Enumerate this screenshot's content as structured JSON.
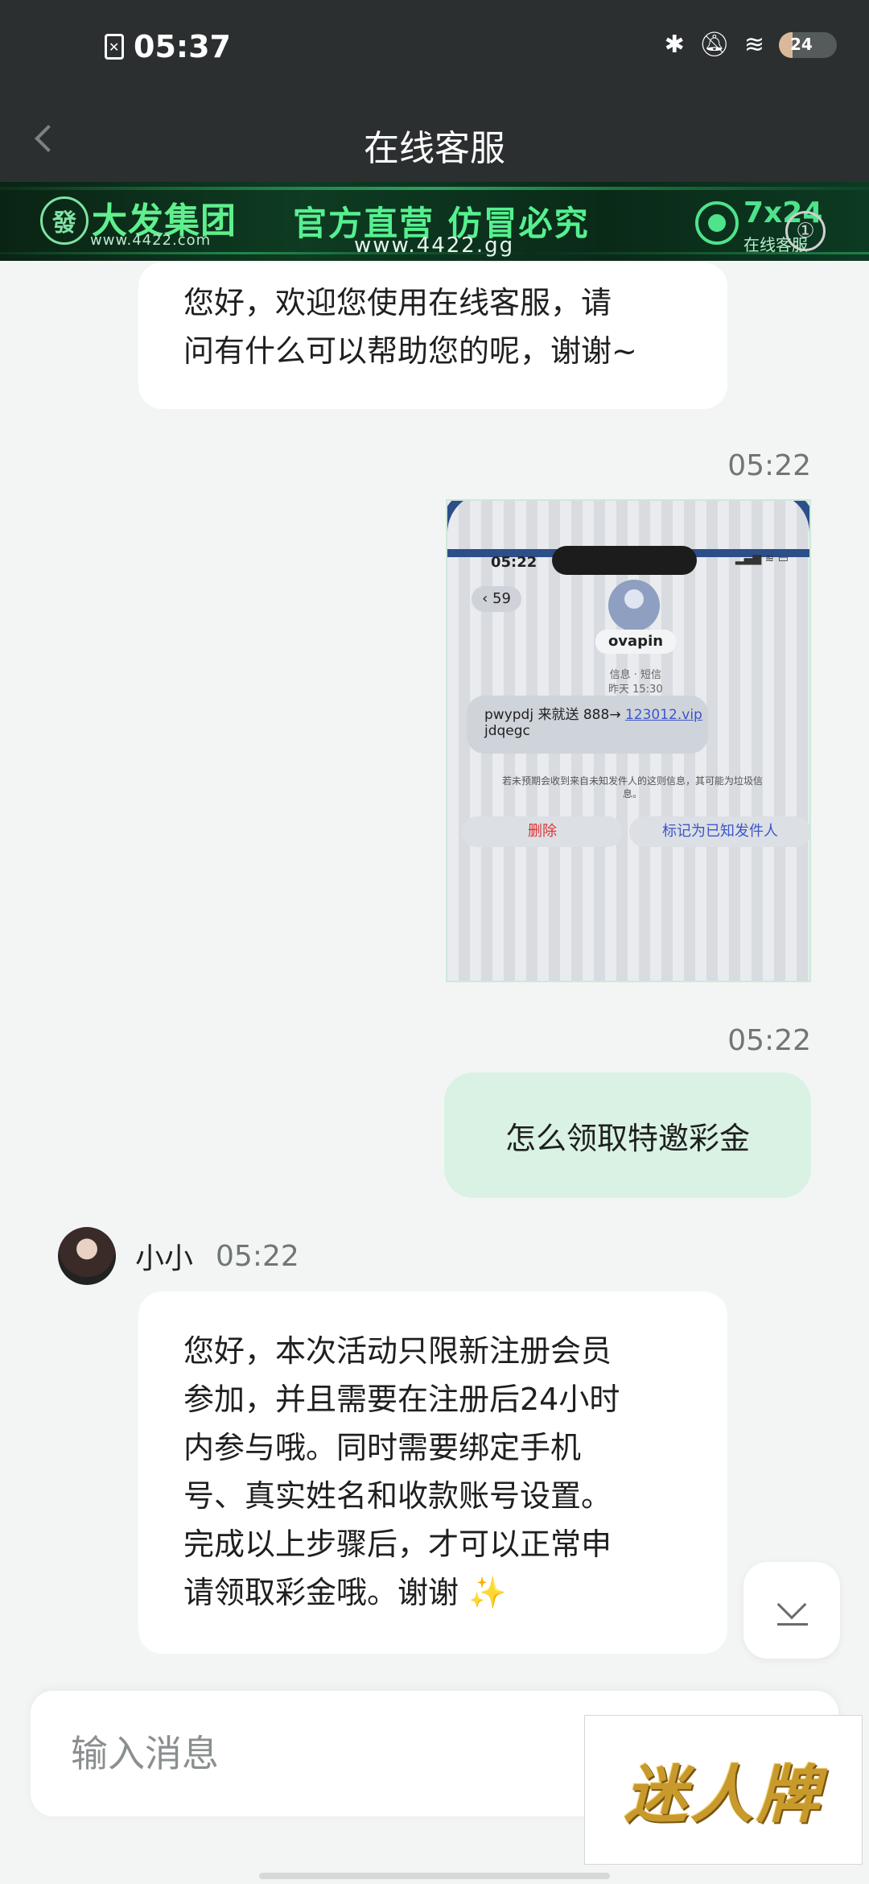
{
  "status_bar": {
    "time": "05:37",
    "battery": "24",
    "battery_level": 0.24
  },
  "nav": {
    "title": "在线客服"
  },
  "banner": {
    "logo_char": "發",
    "brand": "大发集团",
    "brand_url": "www.4422.com",
    "slogan": "官方直营  仿冒必究",
    "slogan_url": "www.4422.gg",
    "service_hours": "7x24",
    "service_label": "在线客服",
    "close_glyph": "①"
  },
  "messages": {
    "greeting_lines": [
      "您好，欢迎您使用在线客服，请",
      "问有什么可以帮助您的呢，谢谢~"
    ],
    "image_time": "05:22",
    "screenshot": {
      "time": "05:22",
      "back_count": "59",
      "contact": "ovapin",
      "meta_line1": "信息 · 短信",
      "meta_line2": "昨天 15:30",
      "sms_line1": "pwypdj  来就送 888→ ",
      "sms_link": "123012.vip",
      "sms_line2": "jdqegc",
      "note": "若未预期会收到来自未知发件人的这则信息，其可能为垃圾信息。",
      "delete_label": "删除",
      "mark_label": "标记为已知发件人"
    },
    "question_time": "05:22",
    "question": "怎么领取特邀彩金",
    "agent_name": "小小",
    "agent_time": "05:22",
    "reply_lines": [
      "您好，本次活动只限新注册会员",
      "参加，并且需要在注册后24小时",
      "内参与哦。同时需要绑定手机",
      "号、真实姓名和收款账号设置。",
      "完成以上步骤后，才可以正常申",
      "请领取彩金哦。谢谢 "
    ],
    "reply_emoji": "✨"
  },
  "input": {
    "placeholder": "输入消息"
  },
  "overlay": {
    "logo_text": "迷人牌"
  },
  "icons": {
    "bluetooth": "bluetooth-icon",
    "mute": "bell-off-icon",
    "wifi": "wifi-icon",
    "scroll_down": "chevron-down-icon"
  }
}
